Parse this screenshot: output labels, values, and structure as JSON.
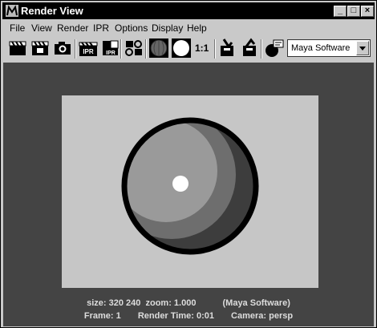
{
  "window": {
    "title": "Render View"
  },
  "menubar": {
    "items": [
      "File",
      "View",
      "Render",
      "IPR",
      "Options",
      "Display",
      "Help"
    ]
  },
  "toolbar": {
    "icons": [
      "render-clapper-icon",
      "redo-render-clapper-icon",
      "snapshot-camera-icon",
      "ipr-render-icon",
      "refresh-ipr-icon",
      "render-region-icon",
      "rgb-channels-icon",
      "alpha-channel-icon"
    ],
    "ratio_label": "1:1",
    "renderer": {
      "selected": "Maya Software"
    }
  },
  "status": {
    "line1": {
      "size": "size:  320  240",
      "zoom": "zoom: 1.000",
      "renderer": "(Maya Software)"
    },
    "line2": {
      "frame": "Frame: 1",
      "render_time": "Render Time: 0:01",
      "camera": "Camera: persp"
    }
  }
}
